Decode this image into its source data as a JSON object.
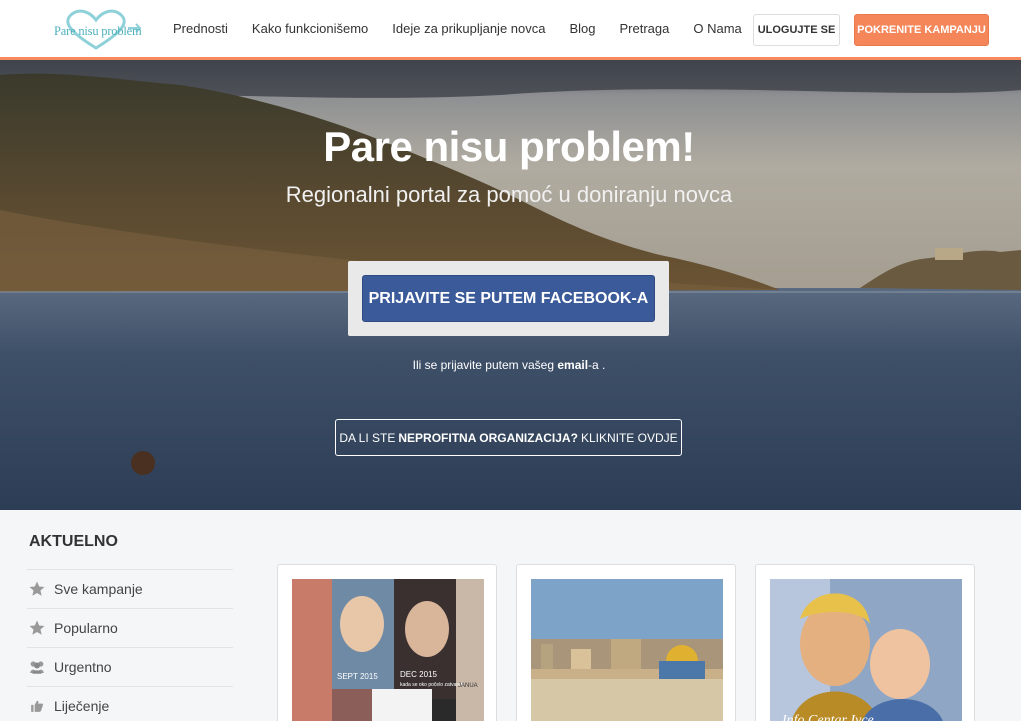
{
  "logo": {
    "text": "Pare nisu problem"
  },
  "nav": {
    "items": [
      "Prednosti",
      "Kako funkcionišemo",
      "Ideje za prikupljanje novca",
      "Blog",
      "Pretraga",
      "O Nama"
    ],
    "login_label": "ULOGUJTE SE",
    "campaign_label": "POKRENITE KAMPANJU"
  },
  "hero": {
    "title": "Pare nisu problem!",
    "subtitle": "Regionalni portal za pomoć u doniranju novca",
    "facebook_label": "PRIJAVITE SE PUTEM FACEBOOK-A",
    "email_prefix": "Ili se prijavite putem vašeg",
    "email_word": "email",
    "email_suffix": "-a .",
    "np_prefix": "DA LI STE",
    "np_bold": "NEPROFITNA ORGANIZACIJA?",
    "np_suffix": "KLIKNITE OVDJE"
  },
  "sidebar": {
    "title": "AKTUELNO",
    "items": [
      {
        "label": "Sve kampanje",
        "icon": "star-icon"
      },
      {
        "label": "Popularno",
        "icon": "star-icon"
      },
      {
        "label": "Urgentno",
        "icon": "users-icon"
      },
      {
        "label": "Liječenje",
        "icon": "thumbs-up-icon"
      }
    ]
  },
  "cards": {
    "card1": {
      "caption1": "SEPT 2015",
      "caption2": "DEC 2015",
      "caption3": "kada se oko počelo zatvarati",
      "caption4": "JANUA"
    },
    "card3": {
      "caption": "Info Centar Ivce"
    }
  },
  "colors": {
    "accent": "#f5865a",
    "facebook": "#3b5a9a",
    "logo": "#4fb0bd"
  }
}
